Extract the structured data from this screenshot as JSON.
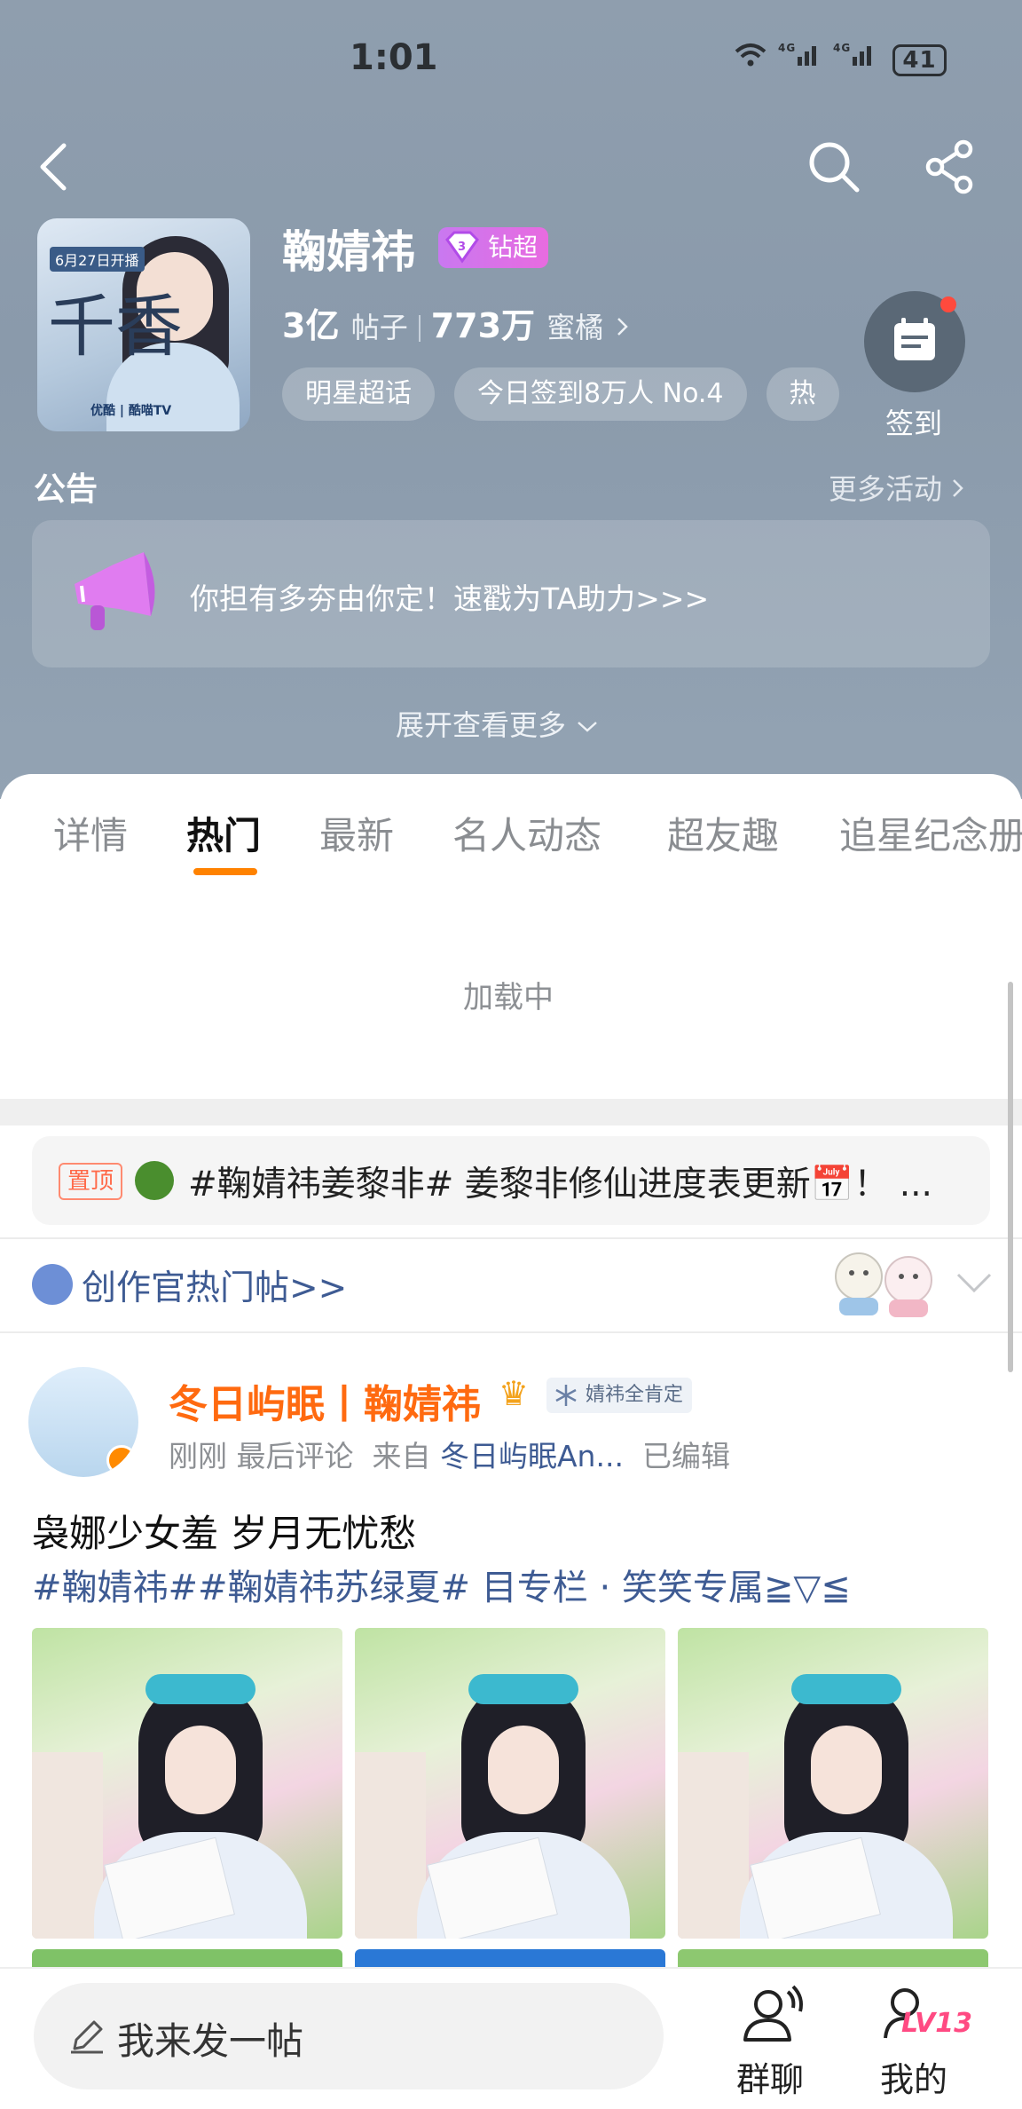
{
  "status_bar": {
    "time": "1:01",
    "signal": "⁶ᵃ ⁴ᴳ‖ ⁴ᴳ‖",
    "battery": "41"
  },
  "header": {
    "title": "鞠婧祎",
    "badge": "钻超",
    "posts_count": "3亿",
    "posts_label": "帖子",
    "fans_count": "773万",
    "fans_label": "蜜橘",
    "tags": [
      "明星超话",
      "今日签到8万人 No.4",
      "热"
    ],
    "checkin_label": "签到",
    "cover_text": {
      "date": "6月27日开播",
      "calligraphy": "千香",
      "brand": "优酷 | 酷喵TV"
    }
  },
  "notice": {
    "title": "公告",
    "more_label": "更多活动",
    "text": "你担有多夯由你定！速戳为TA助力>>>",
    "expand_label": "展开查看更多"
  },
  "tabs": [
    "详情",
    "热门",
    "最新",
    "名人动态",
    "超友趣",
    "追星纪念册"
  ],
  "active_tab": "热门",
  "loading_text": "加载中",
  "pinned": {
    "badge": "置顶",
    "text": "#鞠婧祎姜黎非# 姜黎非修仙进度表更新📅！ ..."
  },
  "creator": {
    "text": "创作官热门帖>>"
  },
  "post": {
    "author": "冬日屿眠丨鞠婧祎",
    "vip_tag": "婧祎全肯定",
    "time": "刚刚",
    "last_comment_label": "最后评论",
    "from_label": "来自",
    "source": "冬日屿眠An...",
    "edited": "已编辑",
    "title": "袅娜少女羞 岁月无忧愁",
    "tags_line": "#鞠婧祎##鞠婧祎苏绿夏#  目专栏 · 笑笑专属≧▽≦"
  },
  "bottom": {
    "compose_placeholder": "我来发一帖",
    "group_chat": "群聊",
    "mine": "我的",
    "level": "LV13"
  },
  "colors": {
    "accent": "#ff8200",
    "link": "#3e5b93",
    "header_bg": "#8f9eae"
  }
}
